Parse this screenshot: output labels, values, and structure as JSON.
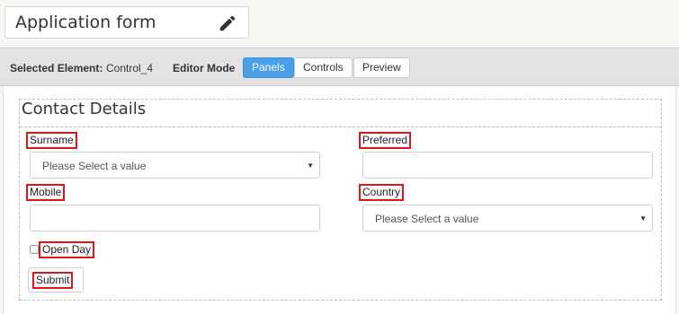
{
  "header": {
    "title": "Application form",
    "edit_icon": "pencil-icon"
  },
  "toolbar": {
    "selected_element_label": "Selected Element:",
    "selected_element_value": "Control_4",
    "editor_mode_label": "Editor Mode",
    "buttons": [
      {
        "label": "Panels",
        "active": true
      },
      {
        "label": "Controls",
        "active": false
      },
      {
        "label": "Preview",
        "active": false
      }
    ]
  },
  "panel": {
    "title": "Contact Details",
    "fields": {
      "surname": {
        "label": "Surname",
        "value": "Please Select a value"
      },
      "preferred": {
        "label": "Preferred",
        "value": ""
      },
      "mobile": {
        "label": "Mobile",
        "value": ""
      },
      "country": {
        "label": "Country",
        "value": "Please Select a value"
      },
      "open_day": {
        "label": "Open Day",
        "checked": false
      }
    },
    "submit_label": "Submit"
  },
  "colors": {
    "active_button": "#4a9fe8",
    "highlight_outline": "#e0141b"
  }
}
